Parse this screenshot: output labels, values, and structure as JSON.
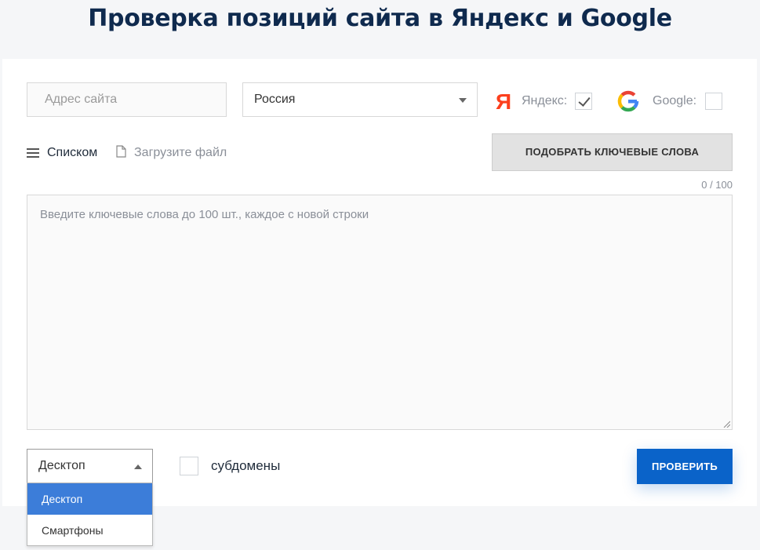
{
  "header": {
    "title": "Проверка позиций сайта в Яндекс и Google"
  },
  "form": {
    "url_placeholder": "Адрес сайта",
    "region": "Россия",
    "yandex": {
      "logo": "Я",
      "label": "Яндекс:",
      "checked": true
    },
    "google": {
      "logo": "G",
      "label": "Google:",
      "checked": false
    },
    "list_mode_label": "Списком",
    "file_mode_label": "Загрузите файл",
    "pick_keywords_button": "ПОДОБРАТЬ КЛЮЧЕВЫЕ СЛОВА",
    "counter": "0 / 100",
    "keywords_placeholder": "Введите ключевые слова до 100 шт., каждое с новой строки",
    "device": {
      "selected": "Десктоп",
      "options": [
        "Десктоп",
        "Смартфоны"
      ]
    },
    "subdomains_label": "субдомены",
    "submit_button": "ПРОВЕРИТЬ"
  },
  "icons": {
    "list": "list-icon",
    "file": "file-icon",
    "yandex": "yandex-logo-icon",
    "google": "google-logo-icon",
    "caret": "chevron-down-icon"
  },
  "colors": {
    "title": "#0f2a4e",
    "primary_button": "#0a63c9",
    "dropdown_selected": "#3c7dd9",
    "yandex_red": "#fc3f1d"
  }
}
